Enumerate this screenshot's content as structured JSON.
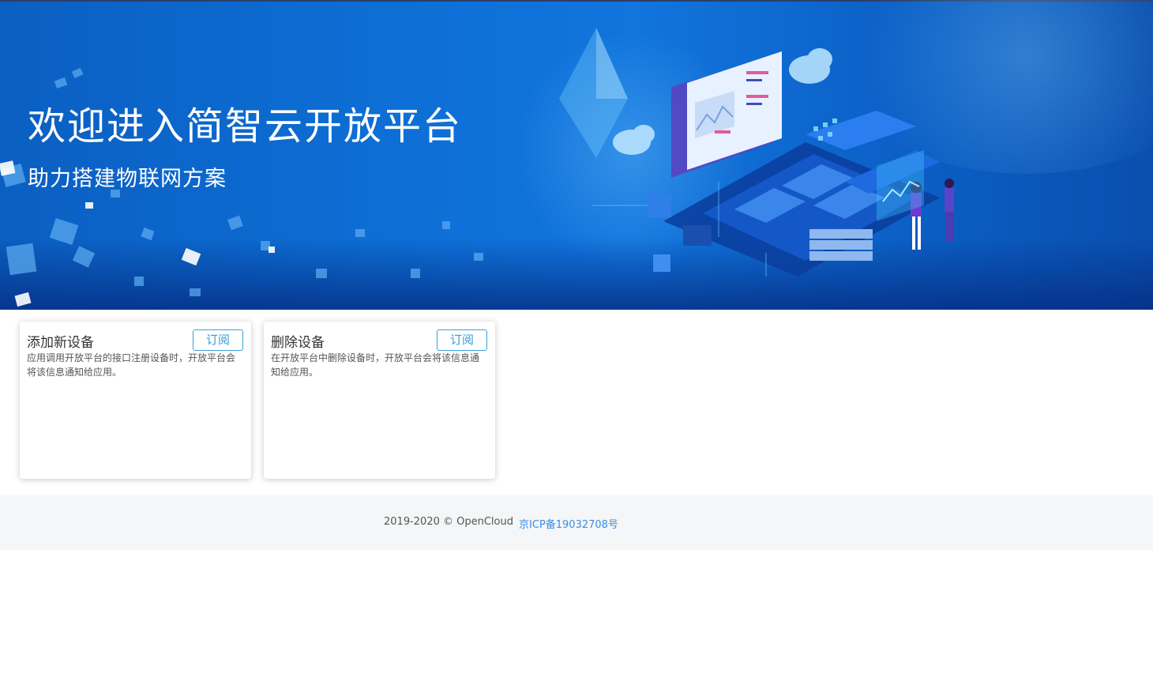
{
  "banner": {
    "title": "欢迎进入简智云开放平台",
    "subtitle": "助力搭建物联网方案"
  },
  "cards": [
    {
      "title": "添加新设备",
      "button_label": "订阅",
      "description": "应用调用开放平台的接口注册设备时，开放平台会将该信息通知给应用。"
    },
    {
      "title": "删除设备",
      "button_label": "订阅",
      "description": "在开放平台中删除设备时，开放平台会将该信息通知给应用。"
    }
  ],
  "footer": {
    "copyright": "2019-2020 © OpenCloud",
    "icp_link": "京ICP备19032708号"
  },
  "colors": {
    "banner_blue": "#0d6fd6",
    "button_accent": "#3aa3d8",
    "link_blue": "#3a8ee6",
    "footer_bg": "#f5f6f7"
  },
  "icons": {
    "banner_illustration": "iot-platform-illustration"
  }
}
